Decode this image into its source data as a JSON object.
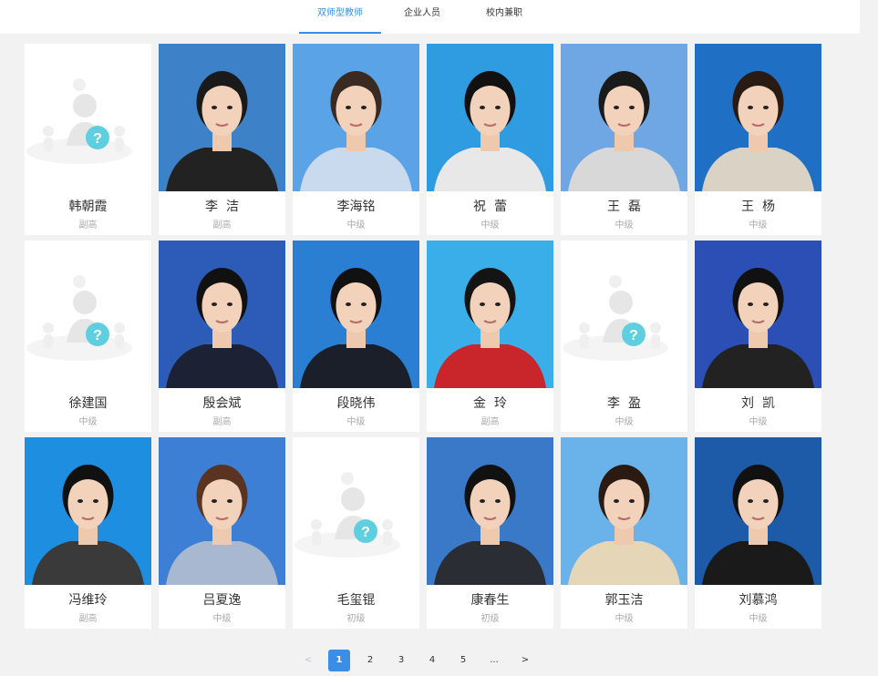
{
  "tabs": [
    {
      "label": "双师型教师",
      "active": true
    },
    {
      "label": "企业人员",
      "active": false
    },
    {
      "label": "校内兼职",
      "active": false
    }
  ],
  "colors": {
    "accent": "#3a8ee6",
    "background": "#f2f2f2",
    "card": "#ffffff"
  },
  "teachers": [
    {
      "name": "韩朝霞",
      "level": "副高",
      "photo": "placeholder-avatar-icon"
    },
    {
      "name": "李  洁",
      "level": "副高",
      "photo": "portrait",
      "bg": "#3d82c8",
      "clothes": "#222222",
      "hair": "#1a1a1a"
    },
    {
      "name": "李海铭",
      "level": "中级",
      "photo": "portrait",
      "bg": "#5aa3e6",
      "clothes": "#c9d9ee",
      "hair": "#3a2a22"
    },
    {
      "name": "祝  蕾",
      "level": "中级",
      "photo": "portrait",
      "bg": "#2f9be0",
      "clothes": "#e8e8e8",
      "hair": "#111111"
    },
    {
      "name": "王  磊",
      "level": "中级",
      "photo": "portrait",
      "bg": "#6fa6e4",
      "clothes": "#d8d8d8",
      "hair": "#1a1a1a"
    },
    {
      "name": "王  杨",
      "level": "中级",
      "photo": "portrait",
      "bg": "#1f6fc4",
      "clothes": "#d9d2c5",
      "hair": "#2a1a14"
    },
    {
      "name": "徐建国",
      "level": "中级",
      "photo": "placeholder-avatar-icon"
    },
    {
      "name": "殷会斌",
      "level": "副高",
      "photo": "portrait",
      "bg": "#2c5cb8",
      "clothes": "#1c2233",
      "hair": "#111111"
    },
    {
      "name": "段晓伟",
      "level": "中级",
      "photo": "portrait",
      "bg": "#2a7fd2",
      "clothes": "#1a1f2a",
      "hair": "#111111"
    },
    {
      "name": "金  玲",
      "level": "副高",
      "photo": "portrait",
      "bg": "#3aaee8",
      "clothes": "#c8262a",
      "hair": "#141414"
    },
    {
      "name": "李  盈",
      "level": "中级",
      "photo": "placeholder-avatar-icon"
    },
    {
      "name": "刘  凯",
      "level": "中级",
      "photo": "portrait",
      "bg": "#2b4fb5",
      "clothes": "#222222",
      "hair": "#111111"
    },
    {
      "name": "冯维玲",
      "level": "副高",
      "photo": "portrait",
      "bg": "#1e8fe0",
      "clothes": "#3a3a3a",
      "hair": "#111111"
    },
    {
      "name": "吕夏逸",
      "level": "中级",
      "photo": "portrait",
      "bg": "#3d7fd4",
      "clothes": "#a8b8d0",
      "hair": "#5a3322"
    },
    {
      "name": "毛玺锟",
      "level": "初级",
      "photo": "placeholder-avatar-icon"
    },
    {
      "name": "康春生",
      "level": "初级",
      "photo": "portrait",
      "bg": "#3a78c8",
      "clothes": "#2a2d33",
      "hair": "#111111"
    },
    {
      "name": "郭玉洁",
      "level": "中级",
      "photo": "portrait",
      "bg": "#6ab2ea",
      "clothes": "#e6d6b8",
      "hair": "#2a1a12"
    },
    {
      "name": "刘慕鸿",
      "level": "中级",
      "photo": "portrait",
      "bg": "#1d5aa8",
      "clothes": "#1a1a1a",
      "hair": "#111111"
    }
  ],
  "pagination": {
    "prev": "<",
    "pages": [
      "1",
      "2",
      "3",
      "4",
      "5"
    ],
    "current": "1",
    "ellipsis": "...",
    "next": ">"
  }
}
